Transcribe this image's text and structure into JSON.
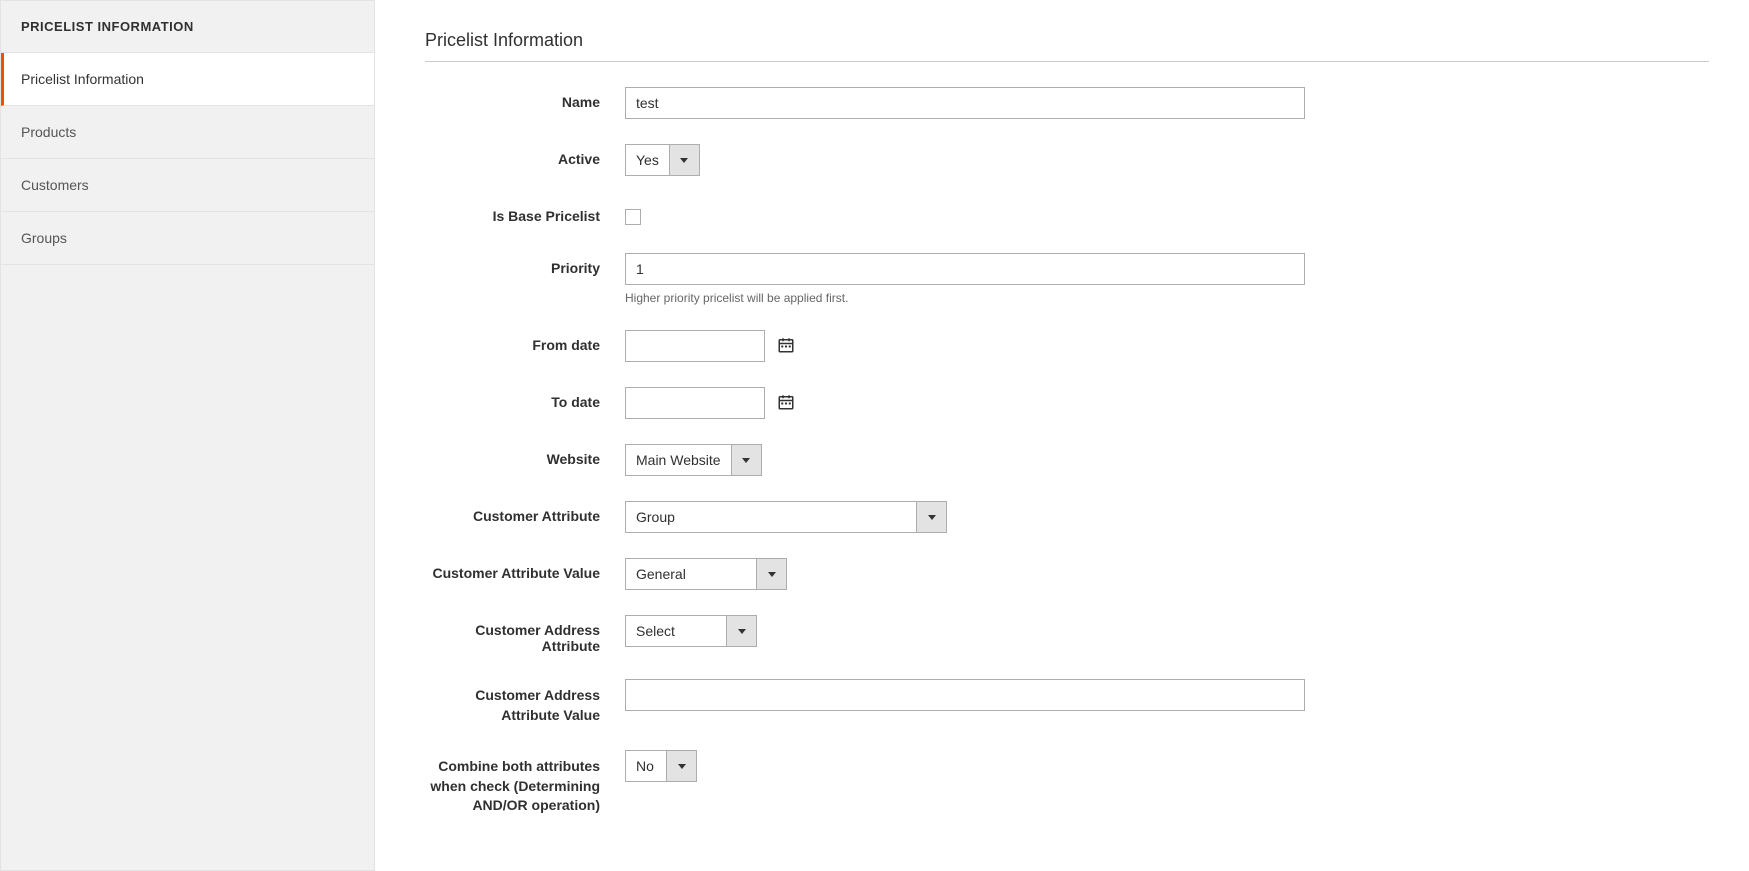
{
  "sidebar": {
    "header": "PRICELIST INFORMATION",
    "items": [
      {
        "label": "Pricelist Information"
      },
      {
        "label": "Products"
      },
      {
        "label": "Customers"
      },
      {
        "label": "Groups"
      }
    ]
  },
  "section_title": "Pricelist Information",
  "fields": {
    "name": {
      "label": "Name",
      "value": "test"
    },
    "active": {
      "label": "Active",
      "value": "Yes"
    },
    "is_base": {
      "label": "Is Base Pricelist"
    },
    "priority": {
      "label": "Priority",
      "value": "1",
      "help": "Higher priority pricelist will be applied first."
    },
    "from_date": {
      "label": "From date",
      "value": ""
    },
    "to_date": {
      "label": "To date",
      "value": ""
    },
    "website": {
      "label": "Website",
      "value": "Main Website"
    },
    "cust_attr": {
      "label": "Customer Attribute",
      "value": "Group"
    },
    "cust_attr_val": {
      "label": "Customer Attribute Value",
      "value": "General"
    },
    "cust_addr_attr": {
      "label": "Customer Address Attribute",
      "value": "Select"
    },
    "cust_addr_attr_val": {
      "label": "Customer Address Attribute Value",
      "value": ""
    },
    "combine": {
      "label": "Combine both attributes when check (Determining AND/OR operation)",
      "value": "No"
    }
  }
}
